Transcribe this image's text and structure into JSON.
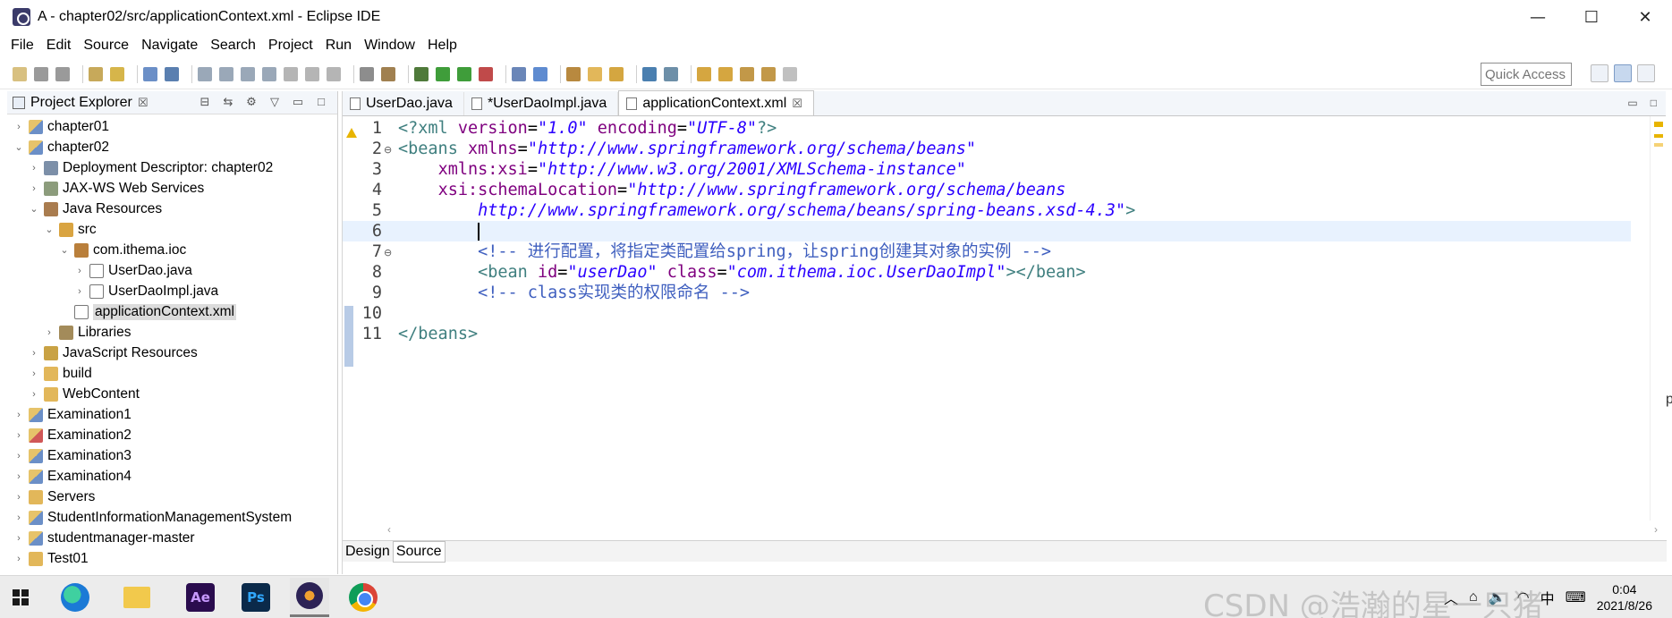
{
  "window": {
    "title": "A - chapter02/src/applicationContext.xml - Eclipse IDE",
    "minimize": "—",
    "maximize": "☐",
    "close": "✕"
  },
  "menu": [
    "File",
    "Edit",
    "Source",
    "Navigate",
    "Search",
    "Project",
    "Run",
    "Window",
    "Help"
  ],
  "toolbar": {
    "quick_access": "Quick Access"
  },
  "explorer": {
    "title": "Project Explorer",
    "close": "☒",
    "tree": [
      {
        "label": "chapter01",
        "depth": 0,
        "twisty": "›",
        "icon": "ic-project"
      },
      {
        "label": "chapter02",
        "depth": 0,
        "twisty": "⌄",
        "icon": "ic-project"
      },
      {
        "label": "Deployment Descriptor: chapter02",
        "depth": 1,
        "twisty": "›",
        "icon": "ic-deploy"
      },
      {
        "label": "JAX-WS Web Services",
        "depth": 1,
        "twisty": "›",
        "icon": "ic-ws"
      },
      {
        "label": "Java Resources",
        "depth": 1,
        "twisty": "⌄",
        "icon": "ic-javares"
      },
      {
        "label": "src",
        "depth": 2,
        "twisty": "⌄",
        "icon": "ic-src"
      },
      {
        "label": "com.ithema.ioc",
        "depth": 3,
        "twisty": "⌄",
        "icon": "ic-pkg"
      },
      {
        "label": "UserDao.java",
        "depth": 4,
        "twisty": "›",
        "icon": "ic-java"
      },
      {
        "label": "UserDaoImpl.java",
        "depth": 4,
        "twisty": "›",
        "icon": "ic-java"
      },
      {
        "label": "applicationContext.xml",
        "depth": 3,
        "twisty": "",
        "icon": "ic-xml",
        "selected": true
      },
      {
        "label": "Libraries",
        "depth": 2,
        "twisty": "›",
        "icon": "ic-lib"
      },
      {
        "label": "JavaScript Resources",
        "depth": 1,
        "twisty": "›",
        "icon": "ic-jsres"
      },
      {
        "label": "build",
        "depth": 1,
        "twisty": "›",
        "icon": "ic-folder"
      },
      {
        "label": "WebContent",
        "depth": 1,
        "twisty": "›",
        "icon": "ic-folder"
      },
      {
        "label": "Examination1",
        "depth": 0,
        "twisty": "›",
        "icon": "ic-project"
      },
      {
        "label": "Examination2",
        "depth": 0,
        "twisty": "›",
        "icon": "ic-proj2"
      },
      {
        "label": "Examination3",
        "depth": 0,
        "twisty": "›",
        "icon": "ic-project"
      },
      {
        "label": "Examination4",
        "depth": 0,
        "twisty": "›",
        "icon": "ic-project"
      },
      {
        "label": "Servers",
        "depth": 0,
        "twisty": "›",
        "icon": "ic-servers"
      },
      {
        "label": "StudentInformationManagementSystem",
        "depth": 0,
        "twisty": "›",
        "icon": "ic-project"
      },
      {
        "label": "studentmanager-master",
        "depth": 0,
        "twisty": "›",
        "icon": "ic-project"
      },
      {
        "label": "Test01",
        "depth": 0,
        "twisty": "›",
        "icon": "ic-servers"
      }
    ]
  },
  "editor": {
    "tabs": [
      {
        "label": "UserDao.java",
        "active": false
      },
      {
        "label": "*UserDaoImpl.java",
        "active": false
      },
      {
        "label": "applicationContext.xml",
        "active": true,
        "close": "☒"
      }
    ],
    "line_numbers": [
      "1",
      "2",
      "3",
      "4",
      "5",
      "6",
      "7",
      "8",
      "9",
      "10",
      "11"
    ],
    "bottom_tabs": [
      "Design",
      "Source"
    ]
  },
  "taskbar": {
    "ime": "中",
    "time": "0:04",
    "date": "2021/8/26",
    "watermark": "CSDN @浩瀚的星一只猪"
  },
  "stray_text": "p"
}
